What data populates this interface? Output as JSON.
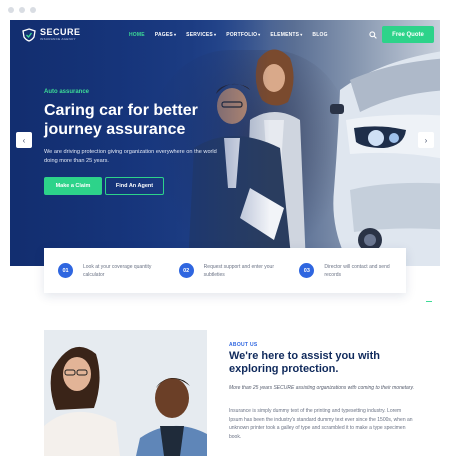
{
  "brand": {
    "name": "SECURE",
    "tagline": "INSURANCE AGENCY"
  },
  "nav": {
    "items": [
      {
        "label": "HOME",
        "active": true,
        "caret": false
      },
      {
        "label": "PAGES",
        "active": false,
        "caret": true
      },
      {
        "label": "SERVICES",
        "active": false,
        "caret": true
      },
      {
        "label": "PORTFOLIO",
        "active": false,
        "caret": true
      },
      {
        "label": "ELEMENTS",
        "active": false,
        "caret": true
      },
      {
        "label": "BLOG",
        "active": false,
        "caret": false
      }
    ],
    "search_icon": "search-icon",
    "quote_label": "Free Quote"
  },
  "hero": {
    "eyebrow": "Auto assurance",
    "headline": "Caring car for better journey assurance",
    "lede": "We are driving protection giving organization everywhere on the world doing more than 25 years.",
    "primary_cta": "Make a Claim",
    "secondary_cta": "Find An Agent",
    "prev_icon": "chevron-left-icon",
    "next_icon": "chevron-right-icon"
  },
  "steps": [
    {
      "num": "01",
      "text": "Look at your coverage quantity calculator"
    },
    {
      "num": "02",
      "text": "Request support and enter your subtleties"
    },
    {
      "num": "03",
      "text": "Director will contact and send records"
    }
  ],
  "about": {
    "label": "ABOUT US",
    "title": "We're here to assist you with exploring protection.",
    "italic": "More than 25 years SECURE assisting organizations with coming to their monetary.",
    "body": "Insurance is simply dummy text of the printing and typesetting industry. Lorem Ipsum has been the industry's standard dummy text ever since the 1500s, when an unknown printer took a galley of type and scrambled it to make a type specimen book."
  },
  "colors": {
    "primary": "#2f66e0",
    "accent": "#2dd38a",
    "heading": "#102a5c",
    "hero": "#1c3f8e"
  }
}
